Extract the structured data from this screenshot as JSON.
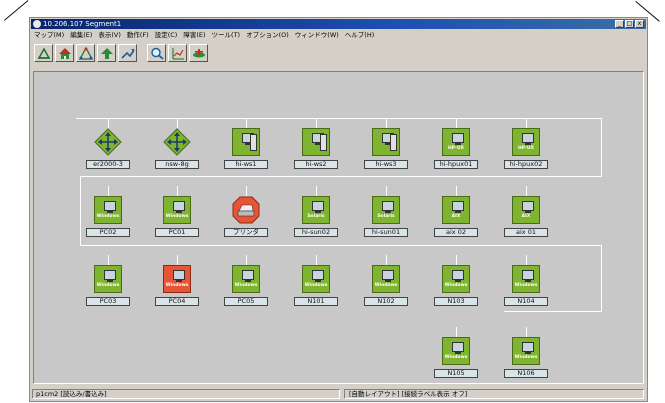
{
  "window": {
    "title": "10.206.107 Segment1",
    "buttons": {
      "minimize": "_",
      "maximize": "□",
      "close": "x"
    }
  },
  "menu": [
    "マップ(M)",
    "編集(E)",
    "表示(V)",
    "動作(F)",
    "設定(C)",
    "障害(E)",
    "ツール(T)",
    "オプション(O)",
    "ウィンドウ(W)",
    "ヘルプ(H)"
  ],
  "toolbar": [
    "map-up-icon",
    "home-icon",
    "network-icon",
    "up-arrow-icon",
    "move-icon",
    "search-icon",
    "chart-icon",
    "device-icon"
  ],
  "rows": [
    [
      {
        "label": "er2000-3",
        "kind": "diamond"
      },
      {
        "label": "nsw-8g",
        "kind": "diamond"
      },
      {
        "label": "hi-ws1",
        "kind": "pc",
        "brand": ""
      },
      {
        "label": "hi-ws2",
        "kind": "pc",
        "brand": ""
      },
      {
        "label": "hi-ws3",
        "kind": "pc",
        "brand": ""
      },
      {
        "label": "hi-hpux01",
        "kind": "pc",
        "brand": "HP-UX"
      },
      {
        "label": "hi-hpux02",
        "kind": "pc",
        "brand": "HP-UX"
      }
    ],
    [
      {
        "label": "PC02",
        "kind": "pc",
        "brand": "Windows"
      },
      {
        "label": "PC01",
        "kind": "pc",
        "brand": "Windows"
      },
      {
        "label": "プリンタ",
        "kind": "printer"
      },
      {
        "label": "hi-sun02",
        "kind": "pc",
        "brand": "Solaris"
      },
      {
        "label": "hi-sun01",
        "kind": "pc",
        "brand": "Solaris"
      },
      {
        "label": "aix 02",
        "kind": "pc",
        "brand": "AIX"
      },
      {
        "label": "aix 01",
        "kind": "pc",
        "brand": "AIX"
      }
    ],
    [
      {
        "label": "PC03",
        "kind": "pc",
        "brand": "Windows"
      },
      {
        "label": "PC04",
        "kind": "pc",
        "brand": "Windows",
        "status": "red"
      },
      {
        "label": "PC05",
        "kind": "pc",
        "brand": "Windows"
      },
      {
        "label": "N101",
        "kind": "pc",
        "brand": "Windows"
      },
      {
        "label": "N102",
        "kind": "pc",
        "brand": "Windows"
      },
      {
        "label": "N103",
        "kind": "pc",
        "brand": "Windows"
      },
      {
        "label": "N104",
        "kind": "pc",
        "brand": "Windows"
      }
    ],
    [
      {
        "label": "N105",
        "kind": "pc",
        "brand": "Windows"
      },
      {
        "label": "N106",
        "kind": "pc",
        "brand": "Windows"
      }
    ]
  ],
  "status": {
    "left": "p1cm2 [読込み/書込み]",
    "right": "[自動レイアウト] [接続ラベル表示 オフ]"
  },
  "colors": {
    "node_ok": "#7fb431",
    "node_alert": "#e85535",
    "canvas": "#c8c8c8"
  }
}
